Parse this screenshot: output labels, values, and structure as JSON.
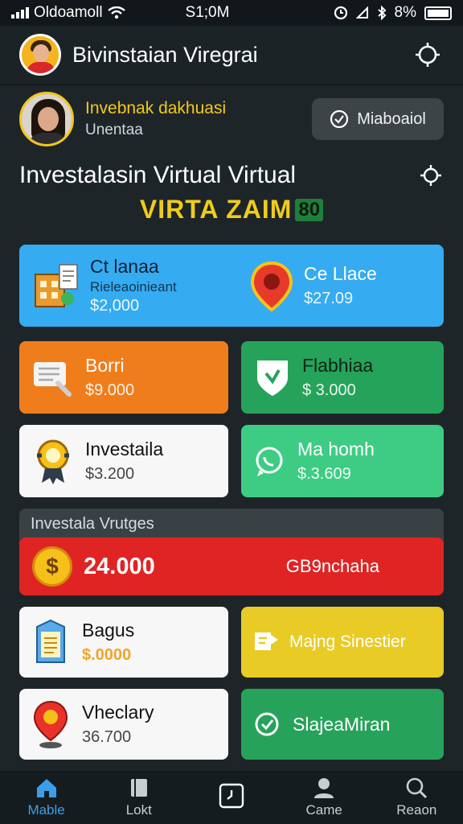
{
  "status_bar": {
    "carrier": "Oldoamoll",
    "time": "S1;0M",
    "battery": "8%"
  },
  "header": {
    "title": "Bivinstaian Viregrai"
  },
  "user": {
    "name": "Invebnak dakhuasi",
    "subtitle": "Unentaa",
    "button_label": "Miaboaiol"
  },
  "section": {
    "title": "Investalasin Virtual Virtual",
    "banner_text": "VIRTA ZAIM",
    "banner_badge": "80"
  },
  "cards": {
    "blue_left": {
      "title": "Ct lanaa",
      "subtitle": "Rieleaoinieant",
      "value": "$2,000"
    },
    "blue_right": {
      "title": "Ce Llace",
      "value": "$27.09"
    },
    "orange": {
      "title": "Borri",
      "value": "$9.000"
    },
    "green_top": {
      "title": "Flabhiaa",
      "value": "$ 3.000"
    },
    "white_top": {
      "title": "Investaila",
      "value": "$3.200"
    },
    "green_mid": {
      "title": "Ma homh",
      "value": "$.3.609"
    },
    "white_mid": {
      "title": "Bagus",
      "value": "$.0000"
    },
    "yellow": {
      "title": "Majng Sinestier"
    },
    "white_bottom": {
      "title": "Vheclary",
      "value": "36.700"
    },
    "green_bottom": {
      "title": "SlajeaMiran"
    }
  },
  "panel": {
    "title": "Investala Vrutges",
    "amount": "24.000",
    "label": "GB9nchaha",
    "coin_symbol": "$"
  },
  "tabs": [
    {
      "label": "Mable",
      "icon": "home-icon",
      "active": true
    },
    {
      "label": "Lokt",
      "icon": "book-icon",
      "active": false
    },
    {
      "label": "",
      "icon": "clock-icon",
      "active": false
    },
    {
      "label": "Came",
      "icon": "person-icon",
      "active": false
    },
    {
      "label": "Reaon",
      "icon": "search-icon",
      "active": false
    }
  ],
  "colors": {
    "accent": "#3c9ee8",
    "gold": "#f0cc1a",
    "red": "#e02424"
  }
}
